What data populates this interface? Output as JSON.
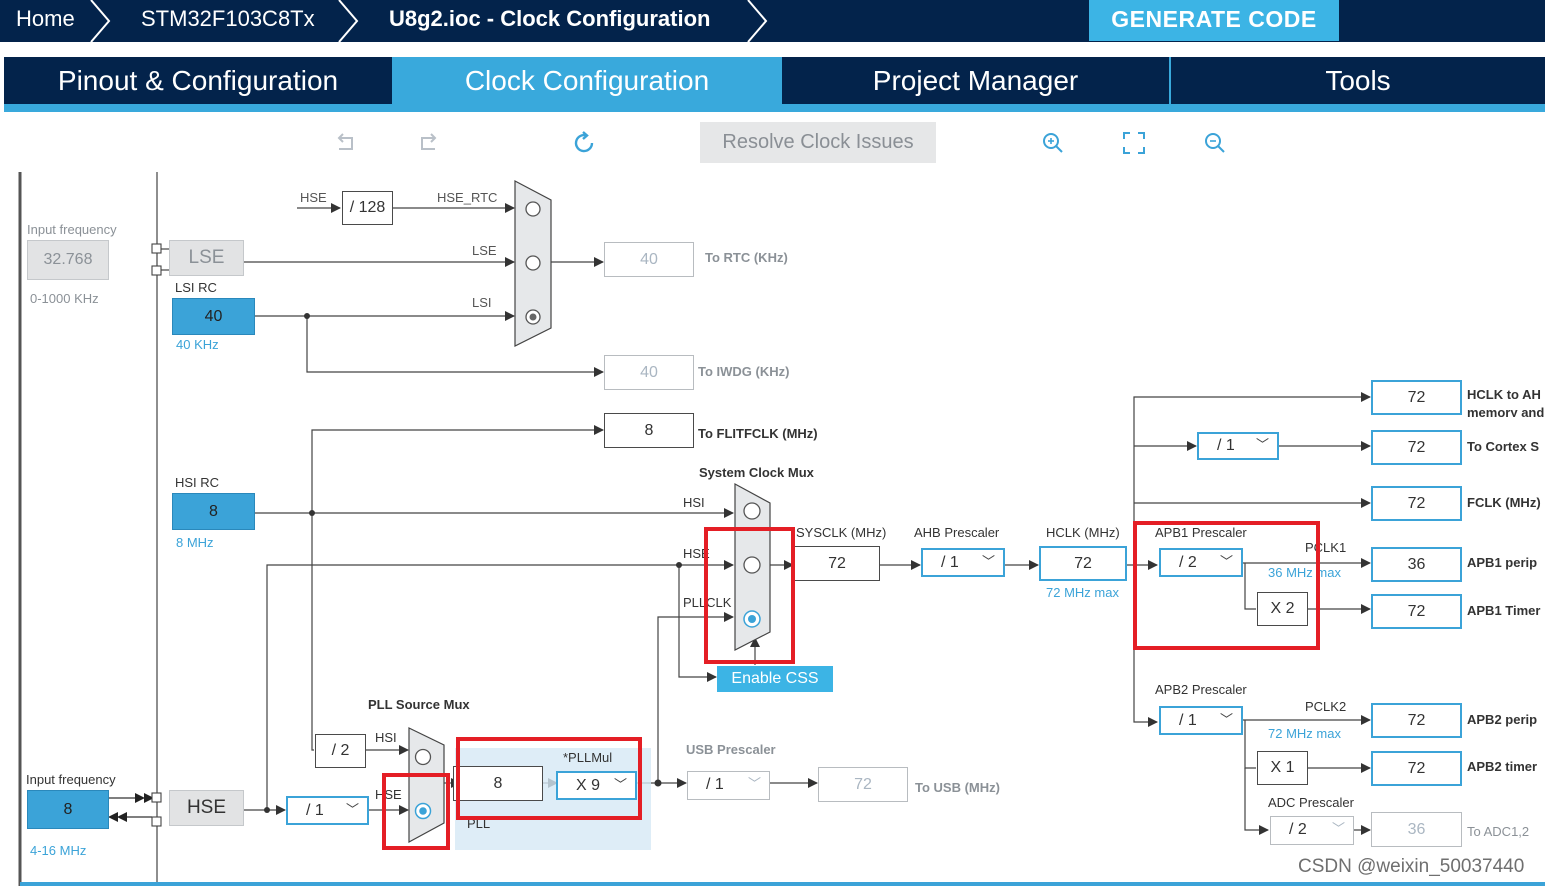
{
  "breadcrumb": {
    "home": "Home",
    "device": "STM32F103C8Tx",
    "file": "U8g2.ioc - Clock Configuration"
  },
  "generate_code": "GENERATE CODE",
  "tabs": [
    {
      "label": "Pinout & Configuration",
      "active": false
    },
    {
      "label": "Clock Configuration",
      "active": true
    },
    {
      "label": "Project Manager",
      "active": false
    },
    {
      "label": "Tools",
      "active": false
    }
  ],
  "toolbar": {
    "resolve": "Resolve Clock Issues",
    "icons": [
      "undo-icon",
      "redo-icon",
      "refresh-icon",
      "zoom-in-icon",
      "fit-screen-icon",
      "zoom-out-icon"
    ]
  },
  "lse": {
    "input_label": "Input frequency",
    "input_value": "32.768",
    "range": "0-1000 KHz",
    "name": "LSE"
  },
  "lsi": {
    "label": "LSI RC",
    "value": "40",
    "freq": "40 KHz"
  },
  "hsi": {
    "label": "HSI RC",
    "value": "8",
    "freq": "8 MHz"
  },
  "hse": {
    "input_label": "Input frequency",
    "input_value": "8",
    "range": "4-16 MHz",
    "name": "HSE"
  },
  "rtc": {
    "hse_label": "HSE",
    "div": "/ 128",
    "hse_rtc": "HSE_RTC",
    "lse_label": "LSE",
    "lsi_label": "LSI",
    "value": "40",
    "dest": "To RTC (KHz)"
  },
  "iwdg": {
    "value": "40",
    "dest": "To IWDG (KHz)"
  },
  "flit": {
    "value": "8",
    "dest": "To FLITFCLK (MHz)"
  },
  "sysmux": {
    "title": "System Clock Mux",
    "hsi": "HSI",
    "hse": "HSE",
    "pllclk": "PLLCLK",
    "enable_css": "Enable CSS"
  },
  "sysclk": {
    "label": "SYSCLK (MHz)",
    "value": "72"
  },
  "ahb": {
    "label": "AHB Prescaler",
    "value": "/ 1"
  },
  "hclk": {
    "label": "HCLK (MHz)",
    "value": "72",
    "max": "72 MHz max"
  },
  "pllsrc": {
    "title": "PLL Source Mux",
    "hsi": "HSI",
    "hse": "HSE",
    "div2": "/ 2",
    "hse_div": "/ 1"
  },
  "pll": {
    "input": "8",
    "mul_label": "*PLLMul",
    "mul": "X 9",
    "label": "PLL"
  },
  "usb": {
    "label": "USB Prescaler",
    "prescaler": "/ 1",
    "value": "72",
    "dest": "To USB (MHz)"
  },
  "outputs": {
    "hclk_ahb": {
      "value": "72",
      "dest": "HCLK to AH",
      "dest2": "memory and"
    },
    "cortex_div": "/ 1",
    "cortex": {
      "value": "72",
      "dest": "To Cortex S"
    },
    "fclk": {
      "value": "72",
      "dest": "FCLK (MHz)"
    }
  },
  "apb1": {
    "label": "APB1 Prescaler",
    "value": "/ 2",
    "pclk": "PCLK1",
    "max": "36 MHz max",
    "timer_mul": "X 2",
    "periph_value": "36",
    "periph_dest": "APB1 perip",
    "timer_value": "72",
    "timer_dest": "APB1 Timer"
  },
  "apb2": {
    "label": "APB2 Prescaler",
    "value": "/ 1",
    "pclk": "PCLK2",
    "max": "72 MHz max",
    "timer_mul": "X 1",
    "periph_value": "72",
    "periph_dest": "APB2 perip",
    "timer_value": "72",
    "timer_dest": "APB2 timer"
  },
  "adc": {
    "label": "ADC Prescaler",
    "value": "/ 2",
    "out": "36",
    "dest": "To ADC1,2"
  },
  "watermark": "CSDN @weixin_50037440",
  "colors": {
    "navy": "#03234b",
    "accent": "#39a9dc",
    "highlight_red": "#e41e25"
  }
}
